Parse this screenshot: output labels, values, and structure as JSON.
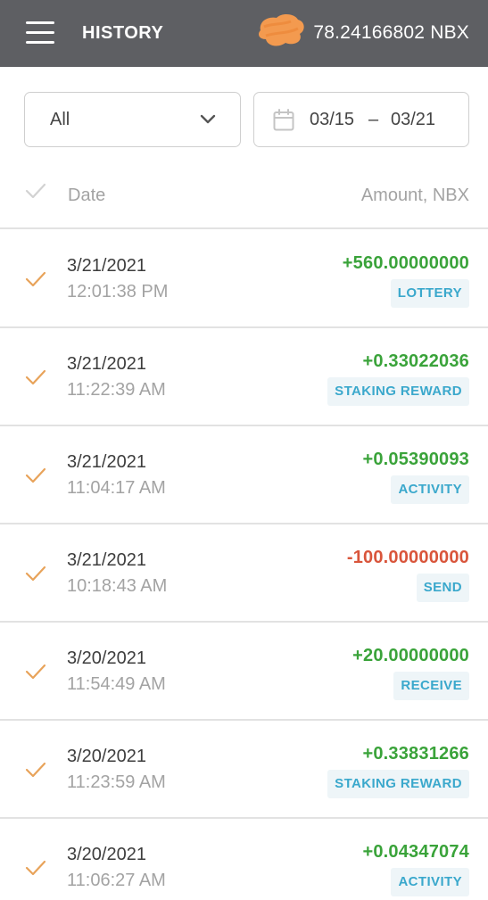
{
  "header": {
    "title": "HISTORY",
    "balance": "78.24166802 NBX",
    "background_color": "#5e5f63"
  },
  "filters": {
    "type_value": "All",
    "date_from": "03/15",
    "date_separator": "–",
    "date_to": "03/21"
  },
  "columns": {
    "date_label": "Date",
    "amount_label": "Amount, NBX"
  },
  "colors": {
    "check": "#e8a35a",
    "positive": "#3aa33a",
    "negative": "#d9553b",
    "tag_text": "#3aa8cc"
  },
  "transactions": [
    {
      "date": "3/21/2021",
      "time": "12:01:38 PM",
      "amount": "+560.00000000",
      "type": "LOTTERY",
      "sign": "positive"
    },
    {
      "date": "3/21/2021",
      "time": "11:22:39 AM",
      "amount": "+0.33022036",
      "type": "STAKING REWARD",
      "sign": "positive"
    },
    {
      "date": "3/21/2021",
      "time": "11:04:17 AM",
      "amount": "+0.05390093",
      "type": "ACTIVITY",
      "sign": "positive"
    },
    {
      "date": "3/21/2021",
      "time": "10:18:43 AM",
      "amount": "-100.00000000",
      "type": "SEND",
      "sign": "negative"
    },
    {
      "date": "3/20/2021",
      "time": "11:54:49 AM",
      "amount": "+20.00000000",
      "type": "RECEIVE",
      "sign": "positive"
    },
    {
      "date": "3/20/2021",
      "time": "11:23:59 AM",
      "amount": "+0.33831266",
      "type": "STAKING REWARD",
      "sign": "positive"
    },
    {
      "date": "3/20/2021",
      "time": "11:06:27 AM",
      "amount": "+0.04347074",
      "type": "ACTIVITY",
      "sign": "positive"
    }
  ]
}
